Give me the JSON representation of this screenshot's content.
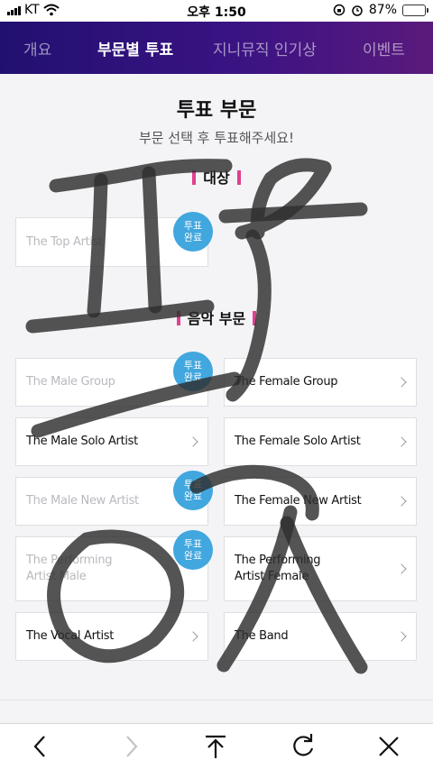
{
  "status_bar": {
    "carrier": "KT",
    "time": "오후 1:50",
    "battery_percent": "87%",
    "battery_level": 0.87,
    "icons": [
      "signal-icon",
      "wifi-icon",
      "orientation-lock-icon",
      "alarm-icon",
      "battery-icon"
    ]
  },
  "nav": {
    "tabs": [
      {
        "label": "개요",
        "active": false
      },
      {
        "label": "부문별 투표",
        "active": true
      },
      {
        "label": "지니뮤직 인기상",
        "active": false
      },
      {
        "label": "이벤트",
        "active": false
      }
    ]
  },
  "main": {
    "title": "투표 부문",
    "subtitle": "부문 선택 후 투표해주세요!",
    "badge_text": [
      "투표",
      "완료"
    ],
    "grand": {
      "heading": "대상",
      "items": [
        {
          "label": "The Top Artist",
          "voted": true
        }
      ]
    },
    "music": {
      "heading": "음악 부문",
      "items": [
        {
          "label": "The Male Group",
          "voted": true
        },
        {
          "label": "The Female Group",
          "voted": false
        },
        {
          "label": "The Male Solo Artist",
          "voted": false
        },
        {
          "label": "The Female Solo Artist",
          "voted": false
        },
        {
          "label": "The Male New Artist",
          "voted": true
        },
        {
          "label": "The Female New Artist",
          "voted": false
        },
        {
          "label": "The Performing Artist Male",
          "voted": true
        },
        {
          "label": "The Performing Artist Female",
          "voted": false
        },
        {
          "label": "The Vocal Artist",
          "voted": false
        },
        {
          "label": "The Band",
          "voted": false
        }
      ]
    }
  },
  "toolbar": {
    "buttons": [
      {
        "icon": "back-icon",
        "enabled": true
      },
      {
        "icon": "forward-icon",
        "enabled": false
      },
      {
        "icon": "scroll-top-icon",
        "enabled": true
      },
      {
        "icon": "refresh-icon",
        "enabled": true
      },
      {
        "icon": "close-icon",
        "enabled": true
      }
    ]
  },
  "colors": {
    "nav_gradient_start": "#221070",
    "nav_gradient_end": "#5a1a7c",
    "badge": "#41a7de",
    "heading_accent": "#e0408f",
    "scribble": "#2e2e2e"
  }
}
